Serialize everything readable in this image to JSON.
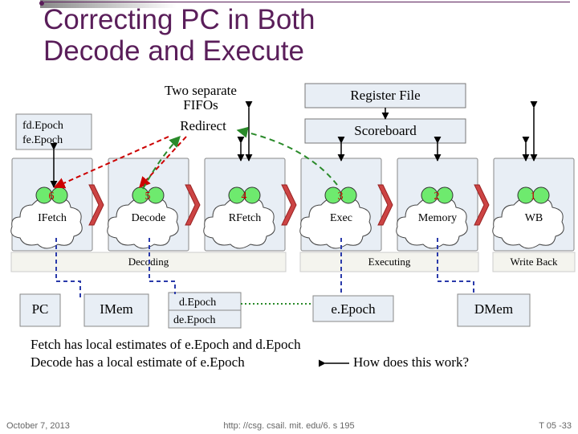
{
  "title": {
    "line1": "Correcting PC in Both",
    "line2": "Decode and Execute"
  },
  "top": {
    "fifos": "Two separate\nFIFOs",
    "redirect": "Redirect",
    "register_file": "Register File",
    "scoreboard": "Scoreboard"
  },
  "epochs": {
    "fd": "fd.Epoch",
    "fe": "fe.Epoch"
  },
  "stages": [
    {
      "num": "6",
      "label": "IFetch"
    },
    {
      "num": "5",
      "label": "Decode"
    },
    {
      "num": "4",
      "label": "RFetch"
    },
    {
      "num": "3",
      "label": "Exec"
    },
    {
      "num": "2",
      "label": "Memory"
    },
    {
      "num": "1",
      "label": "WB"
    }
  ],
  "groups": {
    "decoding": "Decoding",
    "executing": "Executing",
    "writeback": "Write Back"
  },
  "mem": {
    "pc": "PC",
    "imem": "IMem",
    "dmem": "DMem"
  },
  "small_epochs": {
    "d": "d.Epoch",
    "de": "de.Epoch",
    "e": "e.Epoch"
  },
  "body": {
    "l1": "Fetch has local estimates of e.Epoch and d.Epoch",
    "l2": "Decode has a local estimate of e.Epoch",
    "l3": "How does this work?"
  },
  "footer": {
    "date": "October 7, 2013",
    "url": "http: //csg. csail. mit. edu/6. s 195",
    "slide": "T 05 -33"
  }
}
